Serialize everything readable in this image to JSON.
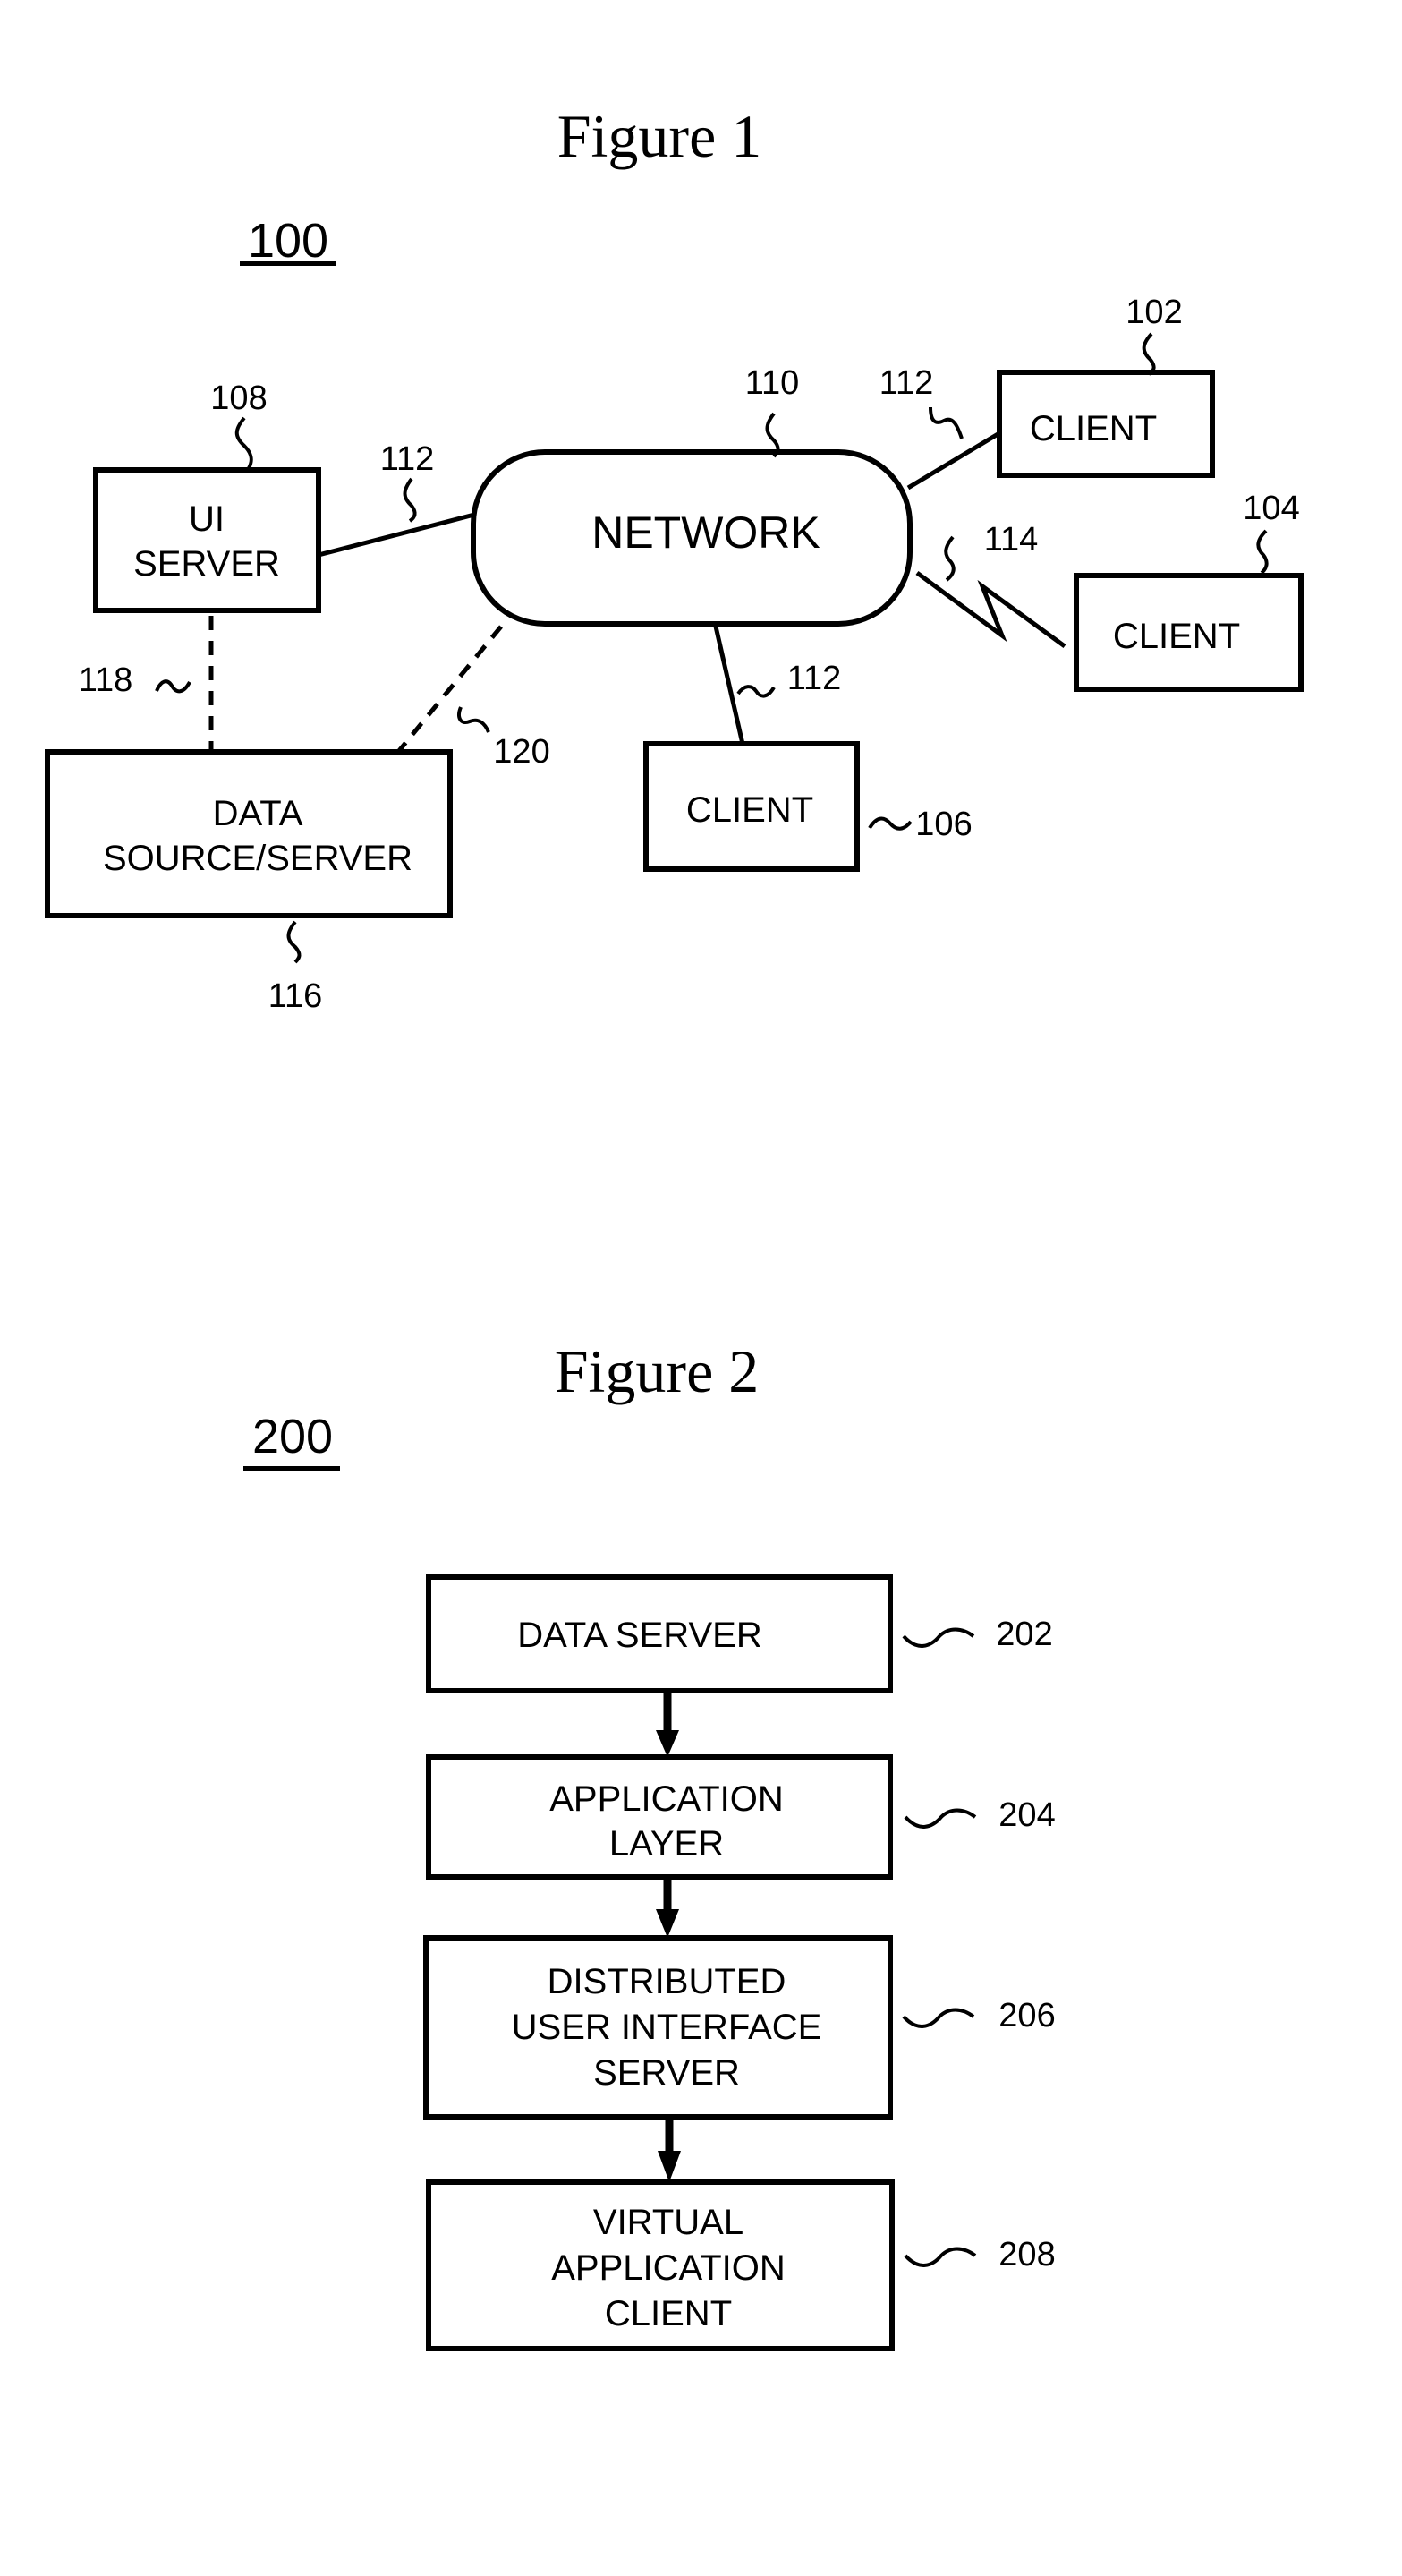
{
  "figure1": {
    "title": "Figure 1",
    "number": "100",
    "nodes": {
      "ui_server": {
        "lines": [
          "UI",
          "SERVER"
        ],
        "ref": "108"
      },
      "network": {
        "label": "NETWORK",
        "ref": "110"
      },
      "client_102": {
        "label": "CLIENT",
        "ref": "102"
      },
      "client_104": {
        "label": "CLIENT",
        "ref": "104"
      },
      "client_106": {
        "label": "CLIENT",
        "ref": "106"
      },
      "data_source": {
        "lines": [
          "DATA",
          "SOURCE/SERVER"
        ],
        "ref": "116"
      }
    },
    "links": {
      "wired_ui": "112",
      "wired_client_102": "112",
      "wired_client_106": "112",
      "wireless_client_104": "114",
      "ui_data": "118",
      "network_data": "120"
    }
  },
  "figure2": {
    "title": "Figure 2",
    "number": "200",
    "boxes": [
      {
        "lines": [
          "DATA SERVER"
        ],
        "ref": "202"
      },
      {
        "lines": [
          "APPLICATION",
          "LAYER"
        ],
        "ref": "204"
      },
      {
        "lines": [
          "DISTRIBUTED",
          "USER INTERFACE",
          "SERVER"
        ],
        "ref": "206"
      },
      {
        "lines": [
          "VIRTUAL",
          "APPLICATION",
          "CLIENT"
        ],
        "ref": "208"
      }
    ]
  }
}
